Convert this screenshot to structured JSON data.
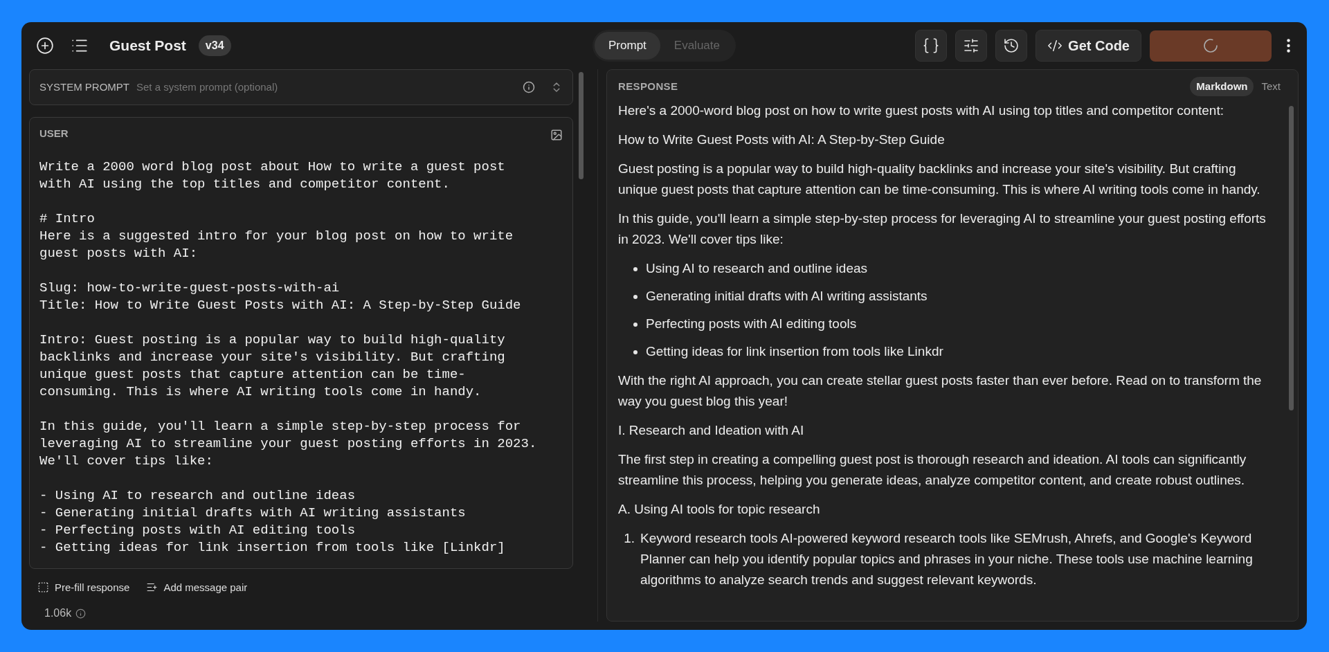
{
  "header": {
    "title": "Guest Post",
    "version": "v34"
  },
  "mode_tabs": [
    {
      "label": "Prompt",
      "selected": true
    },
    {
      "label": "Evaluate",
      "selected": false
    }
  ],
  "toolbar": {
    "get_code": "Get Code",
    "run_loading": true
  },
  "system_prompt": {
    "label": "SYSTEM PROMPT",
    "placeholder": "Set a system prompt (optional)"
  },
  "user": {
    "label": "USER",
    "message": "Write a 2000 word blog post about How to write a guest post\nwith AI using the top titles and competitor content.\n\n# Intro\nHere is a suggested intro for your blog post on how to write\nguest posts with AI:\n\nSlug: how-to-write-guest-posts-with-ai\nTitle: How to Write Guest Posts with AI: A Step-by-Step Guide\n\nIntro: Guest posting is a popular way to build high-quality\nbacklinks and increase your site's visibility. But crafting\nunique guest posts that capture attention can be time-\nconsuming. This is where AI writing tools come in handy.\n\nIn this guide, you'll learn a simple step-by-step process for\nleveraging AI to streamline your guest posting efforts in 2023.\nWe'll cover tips like:\n\n- Using AI to research and outline ideas\n- Generating initial drafts with AI writing assistants\n- Perfecting posts with AI editing tools\n- Getting ideas for link insertion from tools like [Linkdr]"
  },
  "footer": {
    "actions": [
      {
        "kind": "prefill",
        "label": "Pre-fill response"
      },
      {
        "kind": "add_pair",
        "label": "Add message pair"
      }
    ],
    "token_count": "1.06k"
  },
  "response": {
    "label": "RESPONSE",
    "formats": [
      {
        "label": "Markdown",
        "selected": true
      },
      {
        "label": "Text",
        "selected": false
      }
    ],
    "blocks": [
      {
        "kind": "paragraph",
        "text": "Here's a 2000-word blog post on how to write guest posts with AI using top titles and competitor content:"
      },
      {
        "kind": "paragraph",
        "text": "How to Write Guest Posts with AI: A Step-by-Step Guide"
      },
      {
        "kind": "paragraph",
        "text": "Guest posting is a popular way to build high-quality backlinks and increase your site's visibility. But crafting unique guest posts that capture attention can be time-consuming. This is where AI writing tools come in handy."
      },
      {
        "kind": "paragraph",
        "text": "In this guide, you'll learn a simple step-by-step process for leveraging AI to streamline your guest posting efforts in 2023. We'll cover tips like:"
      },
      {
        "kind": "bullets",
        "items": [
          {
            "text": "Using AI to research and outline ideas"
          },
          {
            "text": "Generating initial drafts with AI writing assistants"
          },
          {
            "text": "Perfecting posts with AI editing tools"
          },
          {
            "text": "Getting ideas for link insertion from tools like Linkdr"
          }
        ]
      },
      {
        "kind": "paragraph",
        "text": "With the right AI approach, you can create stellar guest posts faster than ever before. Read on to transform the way you guest blog this year!"
      },
      {
        "kind": "paragraph",
        "text": "I. Research and Ideation with AI"
      },
      {
        "kind": "paragraph",
        "text": "The first step in creating a compelling guest post is thorough research and ideation. AI tools can significantly streamline this process, helping you generate ideas, analyze competitor content, and create robust outlines."
      },
      {
        "kind": "paragraph",
        "text": "A. Using AI tools for topic research"
      },
      {
        "kind": "numbered",
        "items": [
          {
            "number": "1.",
            "text": "Keyword research tools AI-powered keyword research tools like SEMrush, Ahrefs, and Google's Keyword Planner can help you identify popular topics and phrases in your niche. These tools use machine learning algorithms to analyze search trends and suggest relevant keywords."
          }
        ]
      }
    ]
  }
}
